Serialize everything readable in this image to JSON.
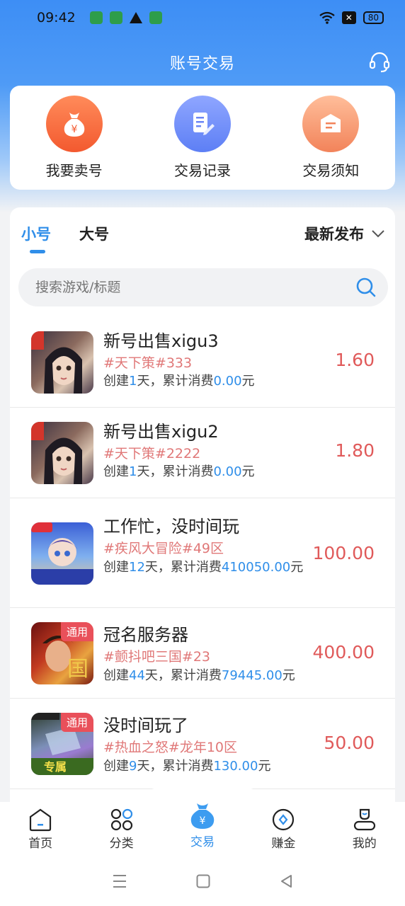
{
  "status": {
    "time": "09:42",
    "battery": "80"
  },
  "header": {
    "title": "账号交易"
  },
  "quick_actions": [
    {
      "label": "我要卖号",
      "icon": "money-bag-icon"
    },
    {
      "label": "交易记录",
      "icon": "document-edit-icon"
    },
    {
      "label": "交易须知",
      "icon": "notice-icon"
    }
  ],
  "tabs": {
    "small": "小号",
    "big": "大号",
    "sort": "最新发布"
  },
  "search": {
    "placeholder": "搜索游戏/标题"
  },
  "items": [
    {
      "title": "新号出售xigu3",
      "tag": "#天下策#333",
      "meta_created_prefix": "创建",
      "days": "1",
      "meta_mid": "天，累计消费",
      "spent": "0.00",
      "meta_suffix": "元",
      "price": "1.60",
      "thumb_badge": ""
    },
    {
      "title": "新号出售xigu2",
      "tag": "#天下策#2222",
      "meta_created_prefix": "创建",
      "days": "1",
      "meta_mid": "天，累计消费",
      "spent": "0.00",
      "meta_suffix": "元",
      "price": "1.80",
      "thumb_badge": ""
    },
    {
      "title": "工作忙，没时间玩",
      "tag": "#疾风大冒险#49区",
      "meta_created_prefix": "创建",
      "days": "12",
      "meta_mid": "天，累计消费",
      "spent": "410050.00",
      "meta_suffix": "元",
      "price": "100.00",
      "thumb_badge": ""
    },
    {
      "title": "冠名服务器",
      "tag": "#颤抖吧三国#23",
      "meta_created_prefix": "创建",
      "days": "44",
      "meta_mid": "天，累计消费",
      "spent": "79445.00",
      "meta_suffix": "元",
      "price": "400.00",
      "thumb_badge": "通用"
    },
    {
      "title": "没时间玩了",
      "tag": "#热血之怒#龙年10区",
      "meta_created_prefix": "创建",
      "days": "9",
      "meta_mid": "天，累计消费",
      "spent": "130.00",
      "meta_suffix": "元",
      "price": "50.00",
      "thumb_badge": "通用"
    }
  ],
  "bottom_nav": [
    {
      "label": "首页",
      "icon": "home-icon"
    },
    {
      "label": "分类",
      "icon": "category-icon"
    },
    {
      "label": "交易",
      "icon": "trade-icon"
    },
    {
      "label": "赚金",
      "icon": "coin-icon"
    },
    {
      "label": "我的",
      "icon": "profile-icon"
    }
  ],
  "colors": {
    "accent": "#2f8ee9",
    "price": "#e05a5a",
    "tag": "#e07878"
  }
}
